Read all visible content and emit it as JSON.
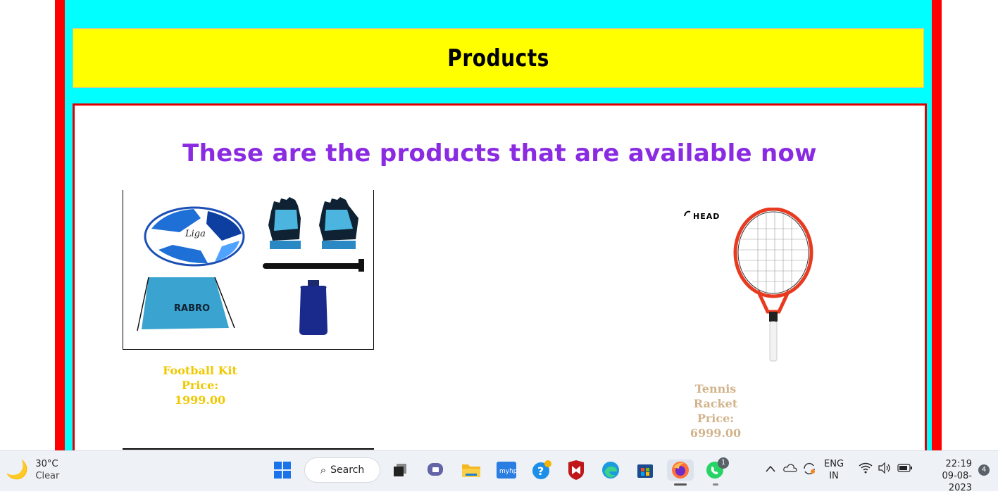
{
  "header": {
    "title": "Products"
  },
  "main": {
    "subtitle": "These are the products that are available now",
    "products": [
      {
        "name": "Football Kit",
        "price": "Price: 1999.00",
        "name_color": "#f0c800"
      },
      {
        "name": "Tennis Racket",
        "price": "Price: 6999.00",
        "name_color": "#d2b48c"
      }
    ],
    "brand_labels": {
      "rabro": "RABRO",
      "liga": "Liga",
      "head": "HEAD"
    }
  },
  "taskbar": {
    "weather": {
      "temp": "30°C",
      "condition": "Clear"
    },
    "search_label": "Search",
    "apps": [
      "start-icon",
      "search",
      "task-view-icon",
      "chat-icon",
      "file-explorer-icon",
      "myhp-icon",
      "help-icon",
      "mcafee-icon",
      "edge-icon",
      "store-icon",
      "firefox-icon",
      "whatsapp-icon"
    ],
    "whatsapp_badge": "1",
    "myhp_label": "myhp",
    "language": {
      "line1": "ENG",
      "line2": "IN"
    },
    "clock": {
      "time": "22:19",
      "date": "09-08-2023"
    },
    "notification_count": "4"
  },
  "colors": {
    "frame": "#ff0000",
    "inner": "#00ffff",
    "header": "#ffff00",
    "subtitle": "#8a2be2"
  }
}
